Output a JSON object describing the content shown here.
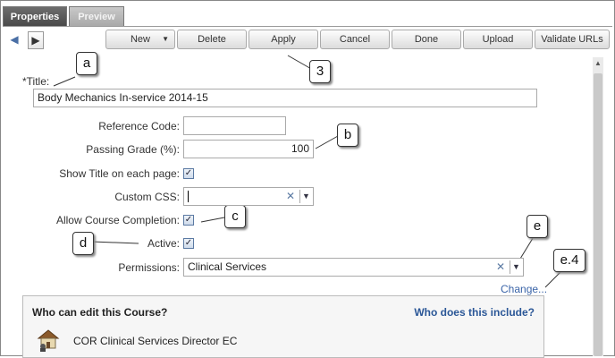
{
  "tabs": [
    {
      "label": "Properties",
      "active": true
    },
    {
      "label": "Preview",
      "active": false
    }
  ],
  "nav": {
    "back_icon": "arrow-left-icon",
    "forward_icon": "arrow-right-icon"
  },
  "toolbar": {
    "new_label": "New",
    "delete_label": "Delete",
    "apply_label": "Apply",
    "cancel_label": "Cancel",
    "done_label": "Done",
    "upload_label": "Upload",
    "validate_label": "Validate URLs"
  },
  "callouts": {
    "a": "a",
    "b": "b",
    "c": "c",
    "d": "d",
    "e": "e",
    "e4": "e.4",
    "three": "3"
  },
  "form": {
    "title_label": "*Title:",
    "title_value": "Body Mechanics In-service 2014-15",
    "reference_code_label": "Reference Code:",
    "reference_code_value": "",
    "passing_grade_label": "Passing Grade (%):",
    "passing_grade_value": "100",
    "show_title_label": "Show Title on each page:",
    "show_title_checked": true,
    "custom_css_label": "Custom CSS:",
    "custom_css_value": "",
    "allow_completion_label": "Allow Course Completion:",
    "allow_completion_checked": true,
    "active_label": "Active:",
    "active_checked": true,
    "permissions_label": "Permissions:",
    "permissions_value": "Clinical Services",
    "change_link": "Change..."
  },
  "who": {
    "title": "Who can edit this Course?",
    "link": "Who does this include?",
    "items": [
      "COR Clinical Services Director EC"
    ]
  },
  "colors": {
    "link": "#3a64a8",
    "tab_active": "#555555",
    "tab_inactive": "#b5b5b5"
  }
}
